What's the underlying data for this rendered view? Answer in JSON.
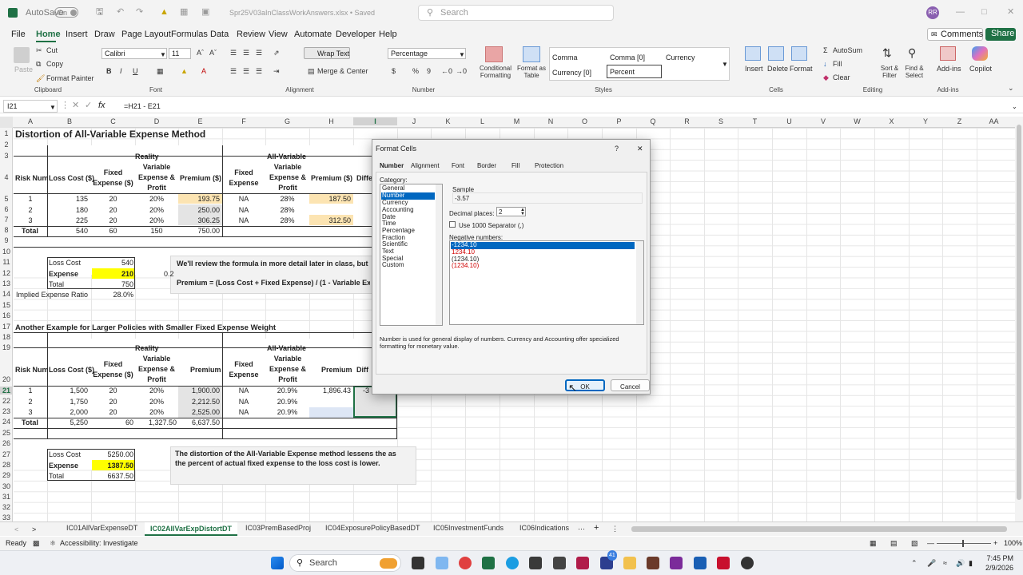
{
  "titlebar": {
    "autosave": "AutoSave",
    "toggle": "On",
    "filename": "Spr25V03aInClassWorkAnswers.xlsx • Saved",
    "search_placeholder": "Search",
    "user_initials": "RR"
  },
  "menu": [
    "File",
    "Home",
    "Insert",
    "Draw",
    "Page Layout",
    "Formulas",
    "Data",
    "Review",
    "View",
    "Automate",
    "Developer",
    "Help"
  ],
  "menu_active": "Home",
  "comments": "Comments",
  "share": "Share",
  "ribbon": {
    "clipboard": {
      "paste": "Paste",
      "cut": "Cut",
      "copy": "Copy",
      "painter": "Format Painter",
      "label": "Clipboard"
    },
    "font": {
      "name": "Calibri",
      "size": "11",
      "label": "Font",
      "bold": "B",
      "italic": "I",
      "underline": "U"
    },
    "alignment": {
      "wrap": "Wrap Text",
      "merge": "Merge & Center",
      "label": "Alignment"
    },
    "number": {
      "format": "Percentage",
      "label": "Number",
      "currency": "$",
      "percent": "%",
      "comma": "9"
    },
    "styles": {
      "cond": "Conditional Formatting",
      "table": "Format as Table",
      "s1": "Comma",
      "s2": "Comma [0]",
      "s3": "Currency",
      "s4": "Currency [0]",
      "s5": "Percent",
      "label": "Styles"
    },
    "cells": {
      "insert": "Insert",
      "delete": "Delete",
      "format": "Format",
      "label": "Cells"
    },
    "editing": {
      "autosum": "AutoSum",
      "fill": "Fill",
      "clear": "Clear",
      "sort": "Sort & Filter",
      "find": "Find & Select",
      "label": "Editing"
    },
    "addins": {
      "addins": "Add-ins",
      "label": "Add-ins"
    },
    "copilot": "Copilot"
  },
  "formula": {
    "namebox": "I21",
    "fx": "fx",
    "content": "=H21 - E21"
  },
  "columns": [
    "A",
    "B",
    "C",
    "D",
    "E",
    "F",
    "G",
    "H",
    "I",
    "J",
    "K",
    "L",
    "M",
    "N",
    "O",
    "P",
    "Q",
    "R",
    "S",
    "T",
    "U",
    "V",
    "W",
    "X",
    "Y",
    "Z",
    "AA"
  ],
  "rows": [
    "1",
    "2",
    "3",
    "4",
    "5",
    "6",
    "7",
    "8",
    "9",
    "10",
    "11",
    "12",
    "13",
    "14",
    "15",
    "16",
    "17",
    "18",
    "19",
    "20",
    "21",
    "22",
    "23",
    "24",
    "25",
    "26",
    "27",
    "28",
    "29",
    "30",
    "31",
    "32",
    "33"
  ],
  "sheet": {
    "title": "Distortion of All-Variable Expense Method",
    "reality": "Reality",
    "allvar": "All-Variable",
    "h_risk": "Risk Num",
    "h_loss": "Loss Cost ($)",
    "h_fixed": "Fixed Expense ($)",
    "h_var": "Variable Expense & Profit",
    "h_prem": "Premium ($)",
    "h_fixed2": "Fixed Expense",
    "h_var2": "Variable Expense & Profit",
    "h_prem2": "Premium ($)",
    "h_diff": "Diffe",
    "t1": [
      [
        "1",
        "135",
        "20",
        "20%",
        "193.75",
        "NA",
        "28%",
        "187.50"
      ],
      [
        "2",
        "180",
        "20",
        "20%",
        "250.00",
        "NA",
        "28%",
        ""
      ],
      [
        "3",
        "225",
        "20",
        "20%",
        "306.25",
        "NA",
        "28%",
        "312.50"
      ]
    ],
    "t1_total": [
      "Total",
      "540",
      "60",
      "150",
      "750.00"
    ],
    "box1": [
      [
        "Loss Cost",
        "540"
      ],
      [
        "Expense",
        "210"
      ],
      [
        "Total",
        "750"
      ]
    ],
    "d12": "0.2",
    "implied_label": "Implied Expense Ratio",
    "implied_val": "28.0%",
    "note1a": "We'll review the formula in more detail later in class, but",
    "note1b": "Premium = (Loss Cost + Fixed Expense) / (1 - Variable Expens",
    "title2": "Another Example for Larger Policies with Smaller Fixed Expense Weight",
    "h_prem3": "Premium",
    "h_prem4": "Premium",
    "h_diff2": "Diff",
    "t2": [
      [
        "1",
        "1,500",
        "20",
        "20%",
        "1,900.00",
        "NA",
        "20.9%",
        "1,896.43",
        "-3"
      ],
      [
        "2",
        "1,750",
        "20",
        "20%",
        "2,212.50",
        "NA",
        "20.9%",
        "",
        ""
      ],
      [
        "3",
        "2,000",
        "20",
        "20%",
        "2,525.00",
        "NA",
        "20.9%",
        "",
        ""
      ]
    ],
    "t2_total": [
      "Total",
      "5,250",
      "60",
      "1,327.50",
      "6,637.50"
    ],
    "box2": [
      [
        "Loss Cost",
        "5250.00"
      ],
      [
        "Expense",
        "1387.50"
      ],
      [
        "Total",
        "6637.50"
      ]
    ],
    "note2": "The distortion of the All-Variable Expense method lessens the as the percent of actual fixed expense to the loss cost is lower."
  },
  "dialog": {
    "title": "Format Cells",
    "help": "?",
    "close": "✕",
    "tabs": [
      "Number",
      "Alignment",
      "Font",
      "Border",
      "Fill",
      "Protection"
    ],
    "category_label": "Category:",
    "categories": [
      "General",
      "Number",
      "Currency",
      "Accounting",
      "Date",
      "Time",
      "Percentage",
      "Fraction",
      "Scientific",
      "Text",
      "Special",
      "Custom"
    ],
    "selected_category": "Number",
    "sample_label": "Sample",
    "sample_value": "-3.57",
    "decimal_label": "Decimal places:",
    "decimal_value": "2",
    "separator_label": "Use 1000 Separator (,)",
    "negative_label": "Negative numbers:",
    "negatives": [
      "-1234.10",
      "1234.10",
      "(1234.10)",
      "(1234.10)"
    ],
    "description": "Number is used for general display of numbers.  Currency and Accounting offer specialized formatting for monetary value.",
    "ok": "OK",
    "cancel": "Cancel"
  },
  "sheettabs": [
    "IC01AllVarExpenseDT",
    "IC02AllVarExpDistortDT",
    "IC03PremBasedProj",
    "IC04ExposurePolicyBasedDT",
    "IC05InvestmentFunds",
    "IC06Indications"
  ],
  "active_sheet": "IC02AllVarExpDistortDT",
  "status": {
    "ready": "Ready",
    "accessibility": "Accessibility: Investigate",
    "zoom": "100%"
  },
  "taskbar": {
    "search": "Search",
    "time": "7:45 PM",
    "date": "2/9/2026",
    "badge": "41"
  },
  "colors": {
    "excel_green": "#1f7145",
    "yellow": "#ffff00",
    "peach": "#fce4b2",
    "lightgray": "#e4e4e4",
    "lightblue": "#dde6f5",
    "accent": "#0067c0"
  }
}
